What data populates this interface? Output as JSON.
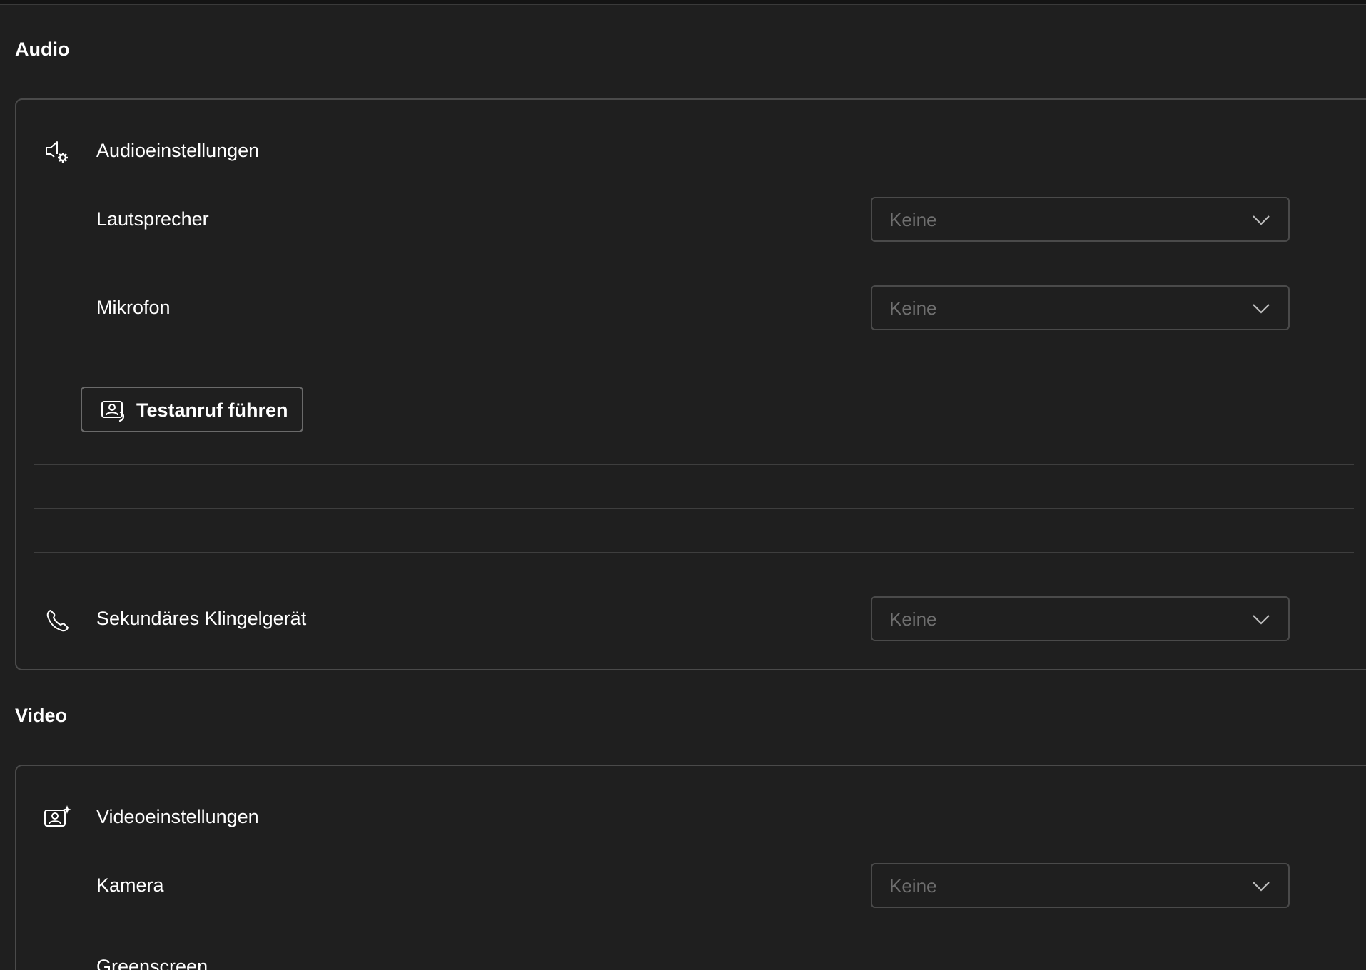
{
  "audio": {
    "heading": "Audio",
    "settings_title": "Audioeinstellungen",
    "speaker": {
      "label": "Lautsprecher",
      "value": "Keine"
    },
    "microphone": {
      "label": "Mikrofon",
      "value": "Keine"
    },
    "test_call_button": "Testanruf führen",
    "secondary_ringer": {
      "label": "Sekundäres Klingelgerät",
      "value": "Keine"
    }
  },
  "video": {
    "heading": "Video",
    "settings_title": "Videoeinstellungen",
    "camera": {
      "label": "Kamera",
      "value": "Keine"
    },
    "greenscreen": {
      "label": "Greenscreen",
      "enabled": false
    }
  },
  "icons": {
    "audio_settings": "speaker-settings-icon",
    "test_call": "video-person-call-icon",
    "secondary_ringer": "phone-icon",
    "video_settings": "video-person-sparkle-icon",
    "dropdown": "chevron-down-icon"
  },
  "colors": {
    "background": "#1f1f1f",
    "border": "#4a4a4a",
    "text": "#ffffff",
    "placeholder": "#6f6f6f"
  }
}
